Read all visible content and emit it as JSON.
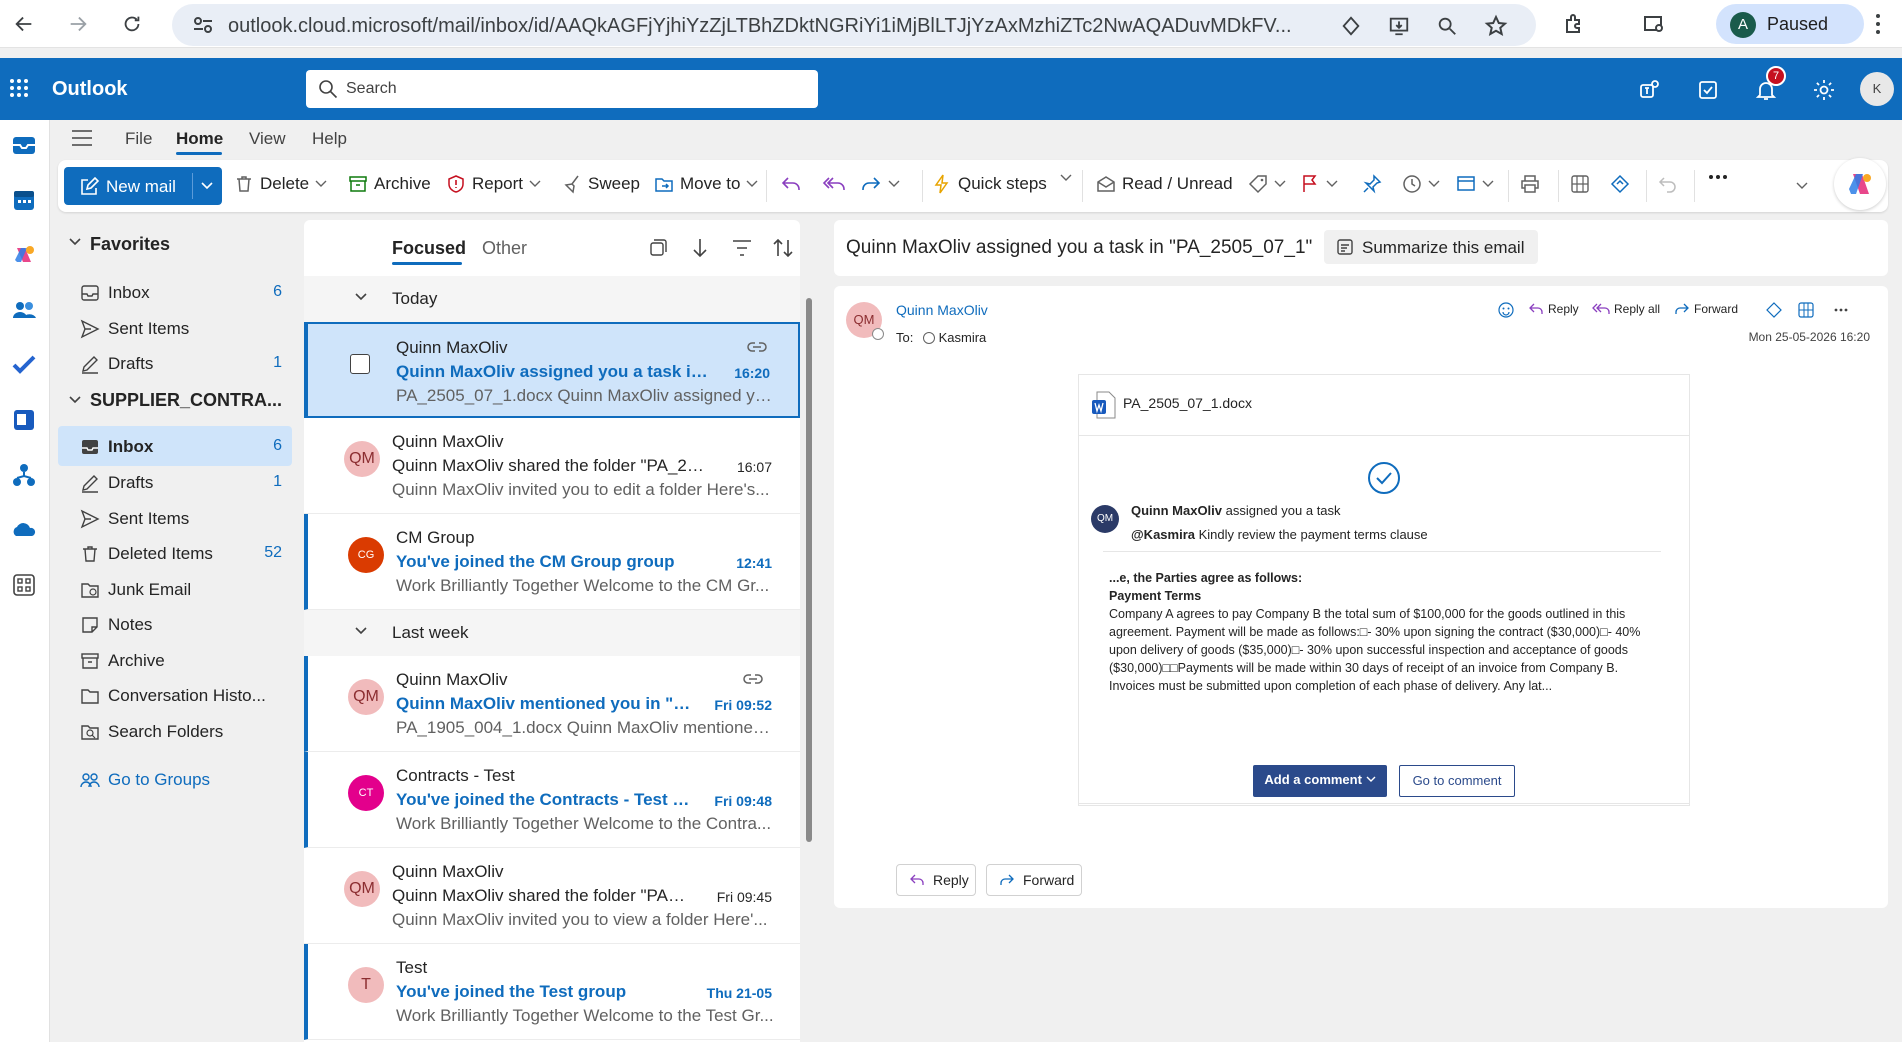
{
  "browser": {
    "url": "outlook.cloud.microsoft/mail/inbox/id/AAQkAGFjYjhiYzZjLTBhZDktNGRiYi1iMjBlLTJjYzAxMzhiZTc2NwAQADuvMDkFV...",
    "profile_initial": "A",
    "profile_status": "Paused"
  },
  "header": {
    "app_name": "Outlook",
    "search_placeholder": "Search",
    "notification_count": "7",
    "account_initial": "K"
  },
  "ribbon_tabs": [
    "File",
    "Home",
    "View",
    "Help"
  ],
  "ribbon": {
    "new_mail": "New mail",
    "delete": "Delete",
    "archive": "Archive",
    "report": "Report",
    "sweep": "Sweep",
    "move_to": "Move to",
    "quick_steps": "Quick steps",
    "read_unread": "Read / Unread"
  },
  "folders": {
    "favorites_title": "Favorites",
    "favorites": [
      {
        "label": "Inbox",
        "count": "6"
      },
      {
        "label": "Sent Items",
        "count": ""
      },
      {
        "label": "Drafts",
        "count": "1"
      }
    ],
    "account_title": "SUPPLIER_CONTRA...",
    "account": [
      {
        "label": "Inbox",
        "count": "6"
      },
      {
        "label": "Drafts",
        "count": "1"
      },
      {
        "label": "Sent Items",
        "count": ""
      },
      {
        "label": "Deleted Items",
        "count": "52"
      },
      {
        "label": "Junk Email",
        "count": ""
      },
      {
        "label": "Notes",
        "count": ""
      },
      {
        "label": "Archive",
        "count": ""
      },
      {
        "label": "Conversation Histo...",
        "count": ""
      },
      {
        "label": "Search Folders",
        "count": ""
      }
    ],
    "go_to_groups": "Go to Groups"
  },
  "message_list": {
    "tab_focused": "Focused",
    "tab_other": "Other",
    "group_today": "Today",
    "group_last_week": "Last week",
    "messages": [
      {
        "avatar": "",
        "sender": "Quinn MaxOliv",
        "subject": "Quinn MaxOliv assigned you a task in \"P...",
        "time": "16:20",
        "preview": "PA_2505_07_1.docx Quinn MaxOliv assigned you ..."
      },
      {
        "avatar": "QM",
        "sender": "Quinn MaxOliv",
        "subject": "Quinn MaxOliv shared the folder \"PA_250...",
        "time": "16:07",
        "preview": "Quinn MaxOliv invited you to edit a folder Here's..."
      },
      {
        "avatar": "CG",
        "sender": "CM Group",
        "subject": "You've joined the CM Group group",
        "time": "12:41",
        "preview": "Work Brilliantly Together Welcome to the CM Gr..."
      },
      {
        "avatar": "QM",
        "sender": "Quinn MaxOliv",
        "subject": "Quinn MaxOliv mentioned you in \"PA...",
        "time": "Fri 09:52",
        "preview": "PA_1905_004_1.docx Quinn MaxOliv mentioned y..."
      },
      {
        "avatar": "CT",
        "sender": "Contracts - Test",
        "subject": "You've joined the Contracts - Test gro...",
        "time": "Fri 09:48",
        "preview": "Work Brilliantly Together Welcome to the Contra..."
      },
      {
        "avatar": "QM",
        "sender": "Quinn MaxOliv",
        "subject": "Quinn MaxOliv shared the folder \"PA_1...",
        "time": "Fri 09:45",
        "preview": "Quinn MaxOliv invited you to view a folder Here'..."
      },
      {
        "avatar": "T",
        "sender": "Test",
        "subject": "You've joined the Test group",
        "time": "Thu 21-05",
        "preview": "Work Brilliantly Together Welcome to the Test Gr..."
      }
    ]
  },
  "reading": {
    "subject": "Quinn MaxOliv assigned you a task in \"PA_2505_07_1\"",
    "summarize": "Summarize this email",
    "sender_initials": "QM",
    "sender": "Quinn MaxOliv",
    "to_label": "To:",
    "to": "Kasmira",
    "reply": "Reply",
    "reply_all": "Reply all",
    "forward": "Forward",
    "date": "Mon 25-05-2026 16:20",
    "attachment": "PA_2505_07_1.docx",
    "task_sender": "Quinn MaxOliv",
    "task_text": " assigned you a task",
    "mention": "@Kasmira",
    "mention_text": " Kindly review the payment terms clause",
    "doc_heading": "...e, the Parties agree as follows:",
    "doc_subheading": "Payment Terms",
    "doc_body": "Company A agrees to pay Company B the total sum of $100,000 for the goods outlined in this agreement. Payment will be made as follows:□- 30% upon signing the contract ($30,000)□- 40% upon delivery of goods ($35,000)□- 30% upon successful inspection and acceptance of goods ($30,000)□□Payments will be made within 30 days of receipt of an invoice from Company B. Invoices must be submitted upon completion of each phase of delivery. Any lat...",
    "add_comment": "Add a comment",
    "go_to_comment": "Go to comment",
    "bottom_reply": "Reply",
    "bottom_forward": "Forward"
  },
  "colors": {
    "brand": "#0f6cbd",
    "selected": "#cfe4fa"
  }
}
